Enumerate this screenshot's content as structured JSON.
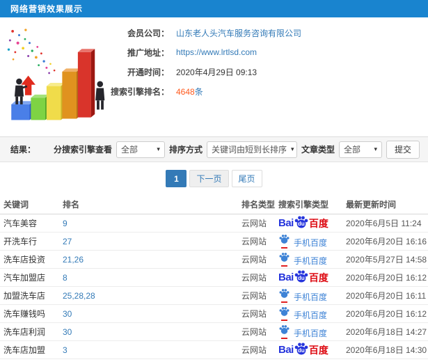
{
  "header": {
    "title": "网络营销效果展示"
  },
  "info": {
    "fields": [
      {
        "label": "会员公司：",
        "value": "山东老人头汽车服务咨询有限公司"
      },
      {
        "label": "推广地址：",
        "value": "https://www.lrtlsd.com"
      },
      {
        "label": "开通时间：",
        "value": "2020年4月29日 09:13"
      },
      {
        "label": "搜索引擎排名：",
        "count": "4648",
        "unit": "条"
      }
    ]
  },
  "filters": {
    "result_label": "结果：",
    "engine_label": "分搜索引擎查看",
    "engine_value": "全部",
    "sort_label": "排序方式",
    "sort_value": "关键词由短到长排序",
    "article_label": "文章类型",
    "article_value": "全部",
    "submit_label": "提交",
    "caret_icon": "▾"
  },
  "pagination": {
    "current": "1",
    "next": "下一页",
    "last": "尾页"
  },
  "table": {
    "headers": [
      "关键词",
      "排名",
      "排名类型",
      "搜索引擎类型",
      "最新更新时间"
    ],
    "engine_labels": {
      "bai": "Bai",
      "du": "du",
      "cn": "百度",
      "mobile": "手机百度"
    },
    "rows": [
      {
        "keyword": "汽车美容",
        "rank": "9",
        "rank_type": "云网站",
        "engine": "baidu",
        "updated": "2020年6月5日 11:24"
      },
      {
        "keyword": "开洗车行",
        "rank": "27",
        "rank_type": "云网站",
        "engine": "mobile-baidu",
        "updated": "2020年6月20日 16:16"
      },
      {
        "keyword": "洗车店投资",
        "rank": "21,26",
        "rank_type": "云网站",
        "engine": "mobile-baidu",
        "updated": "2020年5月27日 14:58"
      },
      {
        "keyword": "汽车加盟店",
        "rank": "8",
        "rank_type": "云网站",
        "engine": "baidu",
        "updated": "2020年6月20日 16:12"
      },
      {
        "keyword": "加盟洗车店",
        "rank": "25,28,28",
        "rank_type": "云网站",
        "engine": "mobile-baidu",
        "updated": "2020年6月20日 16:11"
      },
      {
        "keyword": "洗车赚钱吗",
        "rank": "30",
        "rank_type": "云网站",
        "engine": "mobile-baidu",
        "updated": "2020年6月20日 16:12"
      },
      {
        "keyword": "洗车店利润",
        "rank": "30",
        "rank_type": "云网站",
        "engine": "mobile-baidu",
        "updated": "2020年6月18日 14:27"
      },
      {
        "keyword": "洗车店加盟",
        "rank": "3",
        "rank_type": "云网站",
        "engine": "baidu",
        "updated": "2020年6月18日 14:30"
      }
    ]
  },
  "colors": {
    "topbar": "#1984cf",
    "link": "#337ab7",
    "rank_highlight": "#ff5a1e",
    "baidu_blue": "#2534dc",
    "baidu_red": "#dd0a12",
    "mobile_baidu_blue": "#3e83d6",
    "mobile_baidu_underline": "#e02020"
  }
}
